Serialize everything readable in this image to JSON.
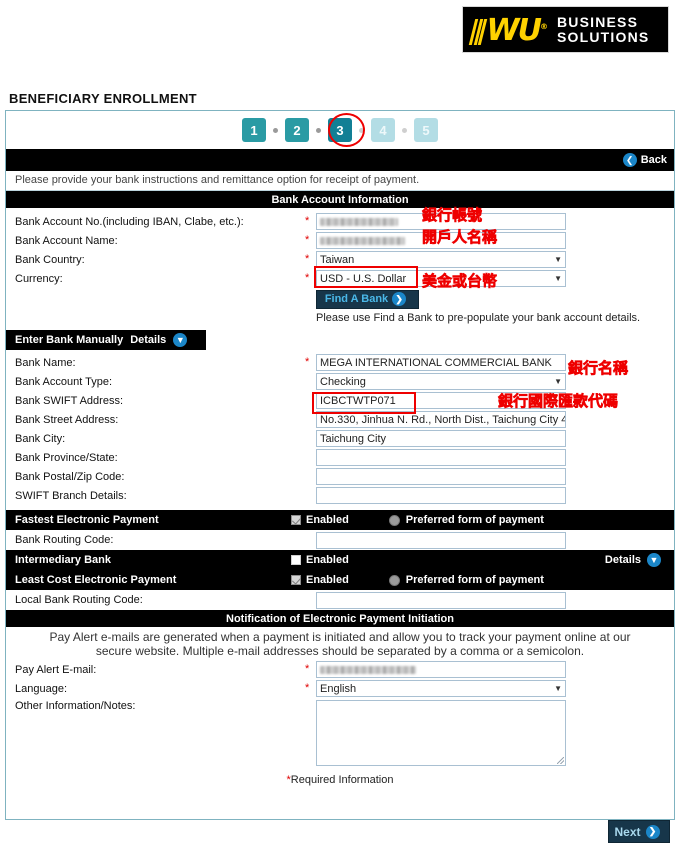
{
  "logo": {
    "mark": "WU",
    "registered": "®",
    "line1": "BUSINESS",
    "line2": "SOLUTIONS"
  },
  "page_title": "BENEFICIARY ENROLLMENT",
  "stepper": {
    "steps": [
      {
        "number": "1",
        "state": "done"
      },
      {
        "number": "2",
        "state": "done"
      },
      {
        "number": "3",
        "state": "current"
      },
      {
        "number": "4",
        "state": "todo"
      },
      {
        "number": "5",
        "state": "todo"
      }
    ]
  },
  "back_button": {
    "label": "Back",
    "icon": "chevron-left-circle-icon",
    "glyph": "❮"
  },
  "instructions": "Please provide your bank instructions and remittance option for receipt of payment.",
  "bank_account_section": {
    "heading": "Bank Account Information",
    "fields": [
      {
        "label": "Bank Account No.(including IBAN, Clabe, etc.):",
        "value": "",
        "redacted": true,
        "required": true,
        "type": "text"
      },
      {
        "label": "Bank Account Name:",
        "value": "",
        "redacted": true,
        "required": true,
        "type": "text"
      },
      {
        "label": "Bank Country:",
        "value": "Taiwan",
        "required": true,
        "type": "select"
      },
      {
        "label": "Currency:",
        "value": "USD - U.S. Dollar",
        "required": true,
        "type": "select"
      }
    ],
    "find_a_bank": {
      "label": "Find A Bank",
      "icon": "chevron-right-circle-icon",
      "glyph": "❯"
    },
    "find_a_bank_hint": "Please use Find a Bank to pre-populate your bank account details."
  },
  "manual_bank_section": {
    "title": "Enter Bank Manually",
    "details_label": "Details",
    "details_icon": "chevron-down-circle-icon",
    "details_glyph": "⌄",
    "fields": [
      {
        "label": "Bank Name:",
        "value": "MEGA INTERNATIONAL COMMERCIAL BANK",
        "required": true,
        "type": "text"
      },
      {
        "label": "Bank Account Type:",
        "value": "Checking",
        "required": false,
        "type": "select"
      },
      {
        "label": "Bank SWIFT Address:",
        "value": "ICBCTWTP071",
        "required": false,
        "type": "text"
      },
      {
        "label": "Bank Street Address:",
        "value": "No.330, Jinhua N. Rd., North Dist., Taichung City 4",
        "required": false,
        "type": "text"
      },
      {
        "label": "Bank City:",
        "value": "Taichung City",
        "required": false,
        "type": "text"
      },
      {
        "label": "Bank Province/State:",
        "value": "",
        "required": false,
        "type": "text"
      },
      {
        "label": "Bank Postal/Zip Code:",
        "value": "",
        "required": false,
        "type": "text"
      },
      {
        "label": "SWIFT Branch Details:",
        "value": "",
        "required": false,
        "type": "text"
      }
    ]
  },
  "payment_options": {
    "fastest": {
      "title": "Fastest Electronic Payment",
      "enabled_label": "Enabled",
      "enabled_checked": true,
      "preferred_label": "Preferred form of payment",
      "field": {
        "label": "Bank Routing Code:",
        "value": ""
      }
    },
    "intermediary": {
      "title": "Intermediary Bank",
      "enabled_label": "Enabled",
      "enabled_checked": false,
      "details_label": "Details",
      "details_icon": "chevron-down-circle-icon",
      "details_glyph": "⌄"
    },
    "least_cost": {
      "title": "Least Cost Electronic Payment",
      "enabled_label": "Enabled",
      "enabled_checked": true,
      "preferred_label": "Preferred form of payment",
      "field": {
        "label": "Local Bank Routing Code:",
        "value": ""
      }
    }
  },
  "notification_section": {
    "heading": "Notification of Electronic Payment Initiation",
    "description": "Pay Alert e-mails are generated when a payment is initiated and allow you to track your payment online at our secure website. Multiple e-mail addresses should be separated by a comma or a semicolon.",
    "fields": [
      {
        "label": "Pay Alert E-mail:",
        "value": "",
        "redacted": true,
        "required": true,
        "type": "text"
      },
      {
        "label": "Language:",
        "value": "English",
        "required": true,
        "type": "select"
      },
      {
        "label": "Other Information/Notes:",
        "value": "",
        "required": false,
        "type": "textarea"
      }
    ]
  },
  "required_note": "Required Information",
  "next_button": {
    "label": "Next",
    "icon": "chevron-right-circle-icon",
    "glyph": "❯"
  },
  "annotations": {
    "step3_circle": "red-ellipse-highlight",
    "account_no": "銀行帳號",
    "account_name": "開戶人名稱",
    "currency": "美金或台幣",
    "bank_name": "銀行名稱",
    "swift": "銀行國際匯款代碼"
  },
  "colors": {
    "accent_teal": "#2a9ba4",
    "current_teal": "#127f95",
    "pending_teal": "#b3dde5",
    "annotation_red": "#ee0000",
    "logo_yellow": "#ffd200",
    "button_navy": "#17364a"
  }
}
